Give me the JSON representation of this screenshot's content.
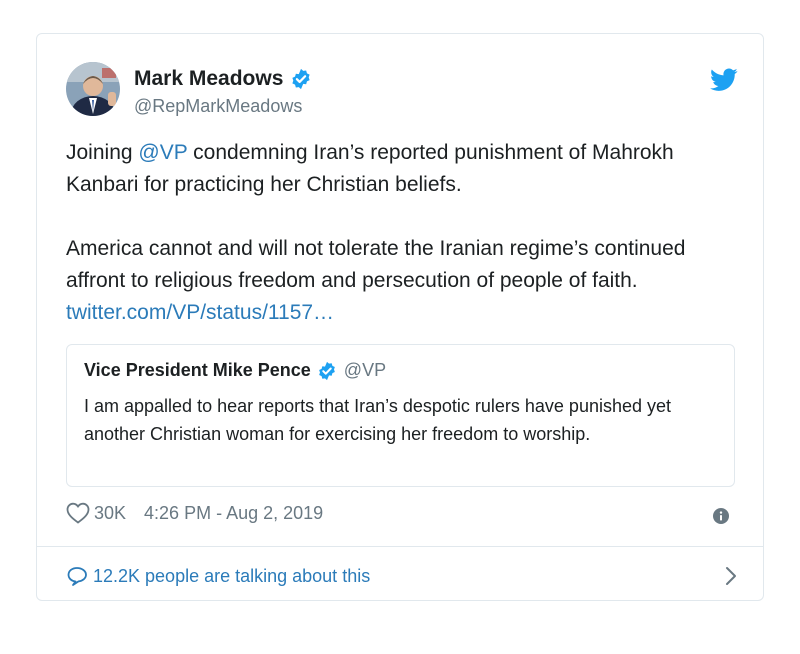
{
  "tweet": {
    "author": {
      "display_name": "Mark Meadows",
      "handle": "@RepMarkMeadows",
      "verified": true
    },
    "text": {
      "line1_prefix": "Joining ",
      "mention": "@VP",
      "line1_suffix": " condemning Iran’s reported punishment of Mahrokh Kanbari for practicing her Christian beliefs.",
      "paragraph2": "America cannot and will not tolerate the Iranian regime’s continued affront to religious freedom and persecution of people of faith. ",
      "link": "twitter.com/VP/status/1157…"
    },
    "quoted": {
      "display_name": "Vice President Mike Pence",
      "handle": "@VP",
      "verified": true,
      "text": "I am appalled to hear reports that Iran’s despotic rulers have punished yet another Christian woman for exercising her freedom to worship."
    },
    "likes": "30K",
    "timestamp": "4:26 PM - Aug 2, 2019",
    "talking": "12.2K people are talking about this"
  },
  "colors": {
    "accent": "#1da1f2",
    "link": "#2b7bb9",
    "text": "#1c2022",
    "muted": "#697882",
    "border": "#e1e8ed"
  },
  "icons": [
    "twitter-bird-icon",
    "verified-badge-icon",
    "heart-icon",
    "info-icon",
    "speech-bubble-icon",
    "chevron-right-icon"
  ]
}
